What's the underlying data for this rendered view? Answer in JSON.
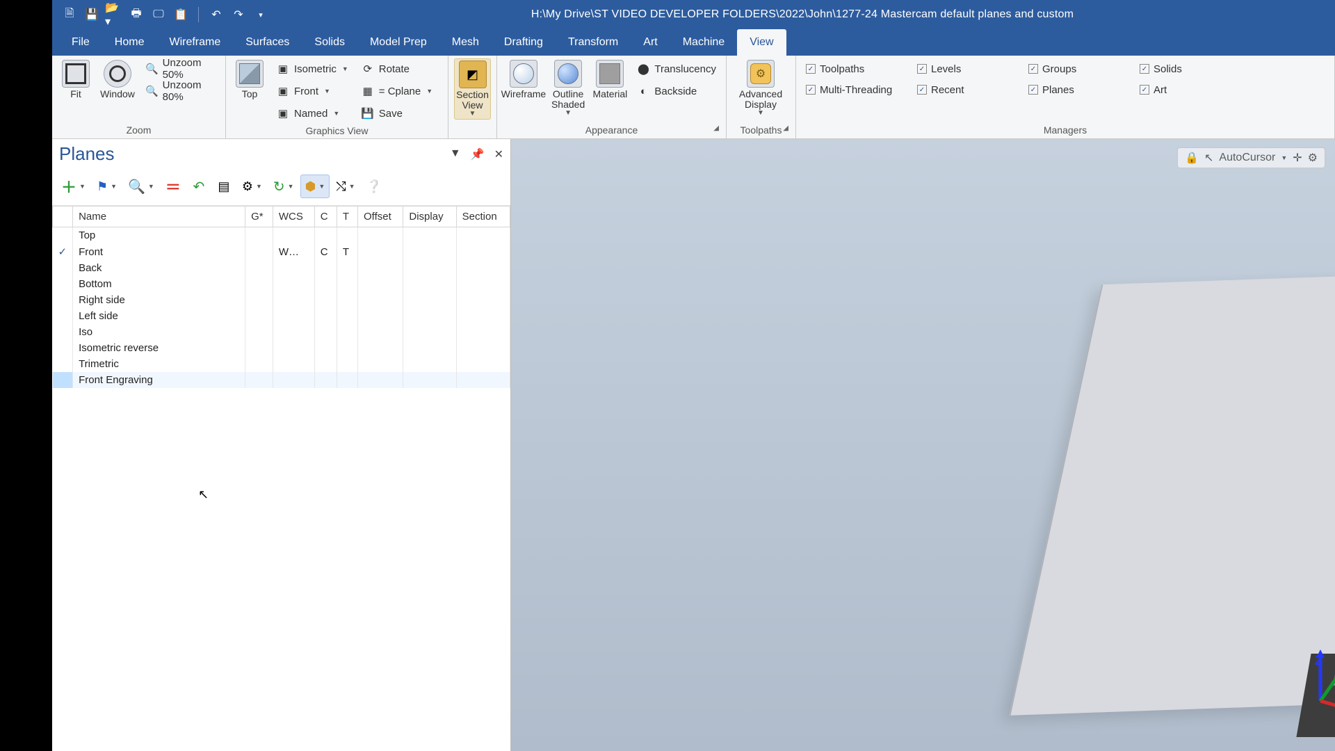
{
  "title_path": "H:\\My Drive\\ST VIDEO DEVELOPER FOLDERS\\2022\\John\\1277-24 Mastercam default planes and custom",
  "tabs": [
    "File",
    "Home",
    "Wireframe",
    "Surfaces",
    "Solids",
    "Model Prep",
    "Mesh",
    "Drafting",
    "Transform",
    "Art",
    "Machine",
    "View"
  ],
  "active_tab": "View",
  "ribbon": {
    "zoom": {
      "label": "Zoom",
      "fit": "Fit",
      "window": "Window",
      "un50": "Unzoom 50%",
      "un80": "Unzoom 80%"
    },
    "graphics": {
      "label": "Graphics View",
      "top": "Top",
      "iso": "Isometric",
      "front": "Front",
      "named": "Named",
      "rotate": "Rotate",
      "cplane": "= Cplane",
      "save": "Save"
    },
    "section": {
      "label": "Section View"
    },
    "appearance": {
      "label": "Appearance",
      "wireframe": "Wireframe",
      "outline": "Outline Shaded",
      "material": "Material",
      "translucency": "Translucency",
      "backside": "Backside"
    },
    "toolpaths": {
      "label": "Toolpaths",
      "advanced": "Advanced Display"
    },
    "managers": {
      "label": "Managers",
      "items": [
        "Toolpaths",
        "Levels",
        "Groups",
        "Solids",
        "Multi-Threading",
        "Recent",
        "Planes",
        "Art"
      ]
    }
  },
  "panel": {
    "title": "Planes",
    "columns": [
      "Name",
      "G*",
      "WCS",
      "C",
      "T",
      "Offset",
      "Display",
      "Section"
    ],
    "rows": [
      {
        "checked": false,
        "name": "Top",
        "wcs": "",
        "c": "",
        "t": ""
      },
      {
        "checked": true,
        "name": "Front",
        "wcs": "W…",
        "c": "C",
        "t": "T"
      },
      {
        "checked": false,
        "name": "Back",
        "wcs": "",
        "c": "",
        "t": ""
      },
      {
        "checked": false,
        "name": "Bottom",
        "wcs": "",
        "c": "",
        "t": ""
      },
      {
        "checked": false,
        "name": "Right side",
        "wcs": "",
        "c": "",
        "t": ""
      },
      {
        "checked": false,
        "name": "Left side",
        "wcs": "",
        "c": "",
        "t": ""
      },
      {
        "checked": false,
        "name": "Iso",
        "wcs": "",
        "c": "",
        "t": ""
      },
      {
        "checked": false,
        "name": "Isometric reverse",
        "wcs": "",
        "c": "",
        "t": ""
      },
      {
        "checked": false,
        "name": "Trimetric",
        "wcs": "",
        "c": "",
        "t": ""
      },
      {
        "checked": false,
        "name": "Front Engraving",
        "wcs": "",
        "c": "",
        "t": "",
        "highlight": true
      }
    ]
  },
  "viewport": {
    "autocursor": "AutoCursor",
    "axes": {
      "x": "X",
      "y": "Y",
      "z": "Z"
    }
  }
}
